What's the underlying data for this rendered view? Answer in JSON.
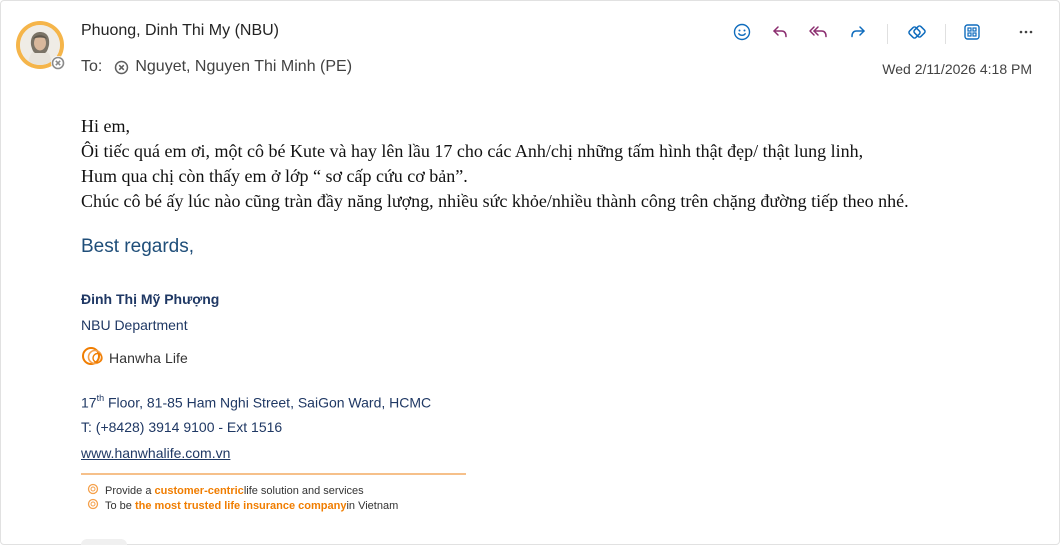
{
  "email": {
    "sender": "Phuong, Dinh Thi My (NBU)",
    "to_label": "To:",
    "recipient": "Nguyet, Nguyen Thi Minh (PE)",
    "datetime": "Wed 2/11/2026 4:18 PM"
  },
  "toolbar": {
    "icons": [
      "emoji-icon",
      "reply-icon",
      "reply-all-icon",
      "forward-icon",
      "loop-icon",
      "apps-icon",
      "more-icon"
    ]
  },
  "body": {
    "lines": [
      "Hi em,",
      "Ôi tiếc quá em ơi, một cô bé Kute và hay lên lầu 17 cho các Anh/chị những tấm hình thật đẹp/ thật lung linh,",
      "Hum qua chị còn thấy em ở lớp “ sơ cấp cứu cơ bản”.",
      "Chúc cô bé ấy lúc nào cũng tràn đầy năng lượng, nhiều sức khỏe/nhiều thành công trên chặng đường tiếp theo nhé."
    ]
  },
  "signature": {
    "regards": "Best regards,",
    "name": "Đinh Thị Mỹ Phượng",
    "department": "NBU Department",
    "logo_text": "Hanwha Life",
    "address_prefix": "17",
    "address_sup": "th",
    "address_rest": " Floor, 81-85 Ham Nghi Street, SaiGon Ward, HCMC",
    "phone": "T: (+8428) 3914 9100 - Ext 1516",
    "website": "www.hanwhalife.com.vn",
    "tagline1": {
      "pre": "Provide a ",
      "highlight": "customer-centric",
      "post": " life solution and services"
    },
    "tagline2": {
      "pre": "To be ",
      "highlight": "the most trusted life insurance company",
      "post": " in Vietnam"
    }
  },
  "colors": {
    "accent": "#0f6cbd",
    "brand_orange": "#f07d00",
    "signature_blue": "#1f3864"
  }
}
